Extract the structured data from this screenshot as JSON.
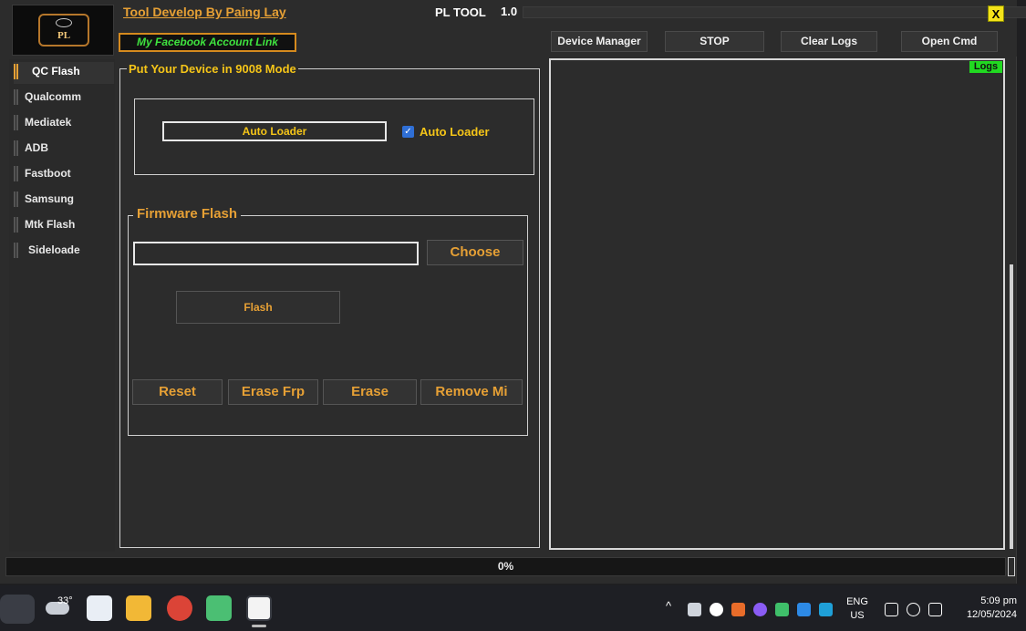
{
  "app": {
    "developer_link": "Tool Develop By Paing Lay",
    "name": "PL TOOL",
    "version": "1.0",
    "logo_text": "PL",
    "close_glyph": "X",
    "facebook_link": "My Facebook Account Link"
  },
  "toolbar": {
    "device_manager": "Device Manager",
    "stop": "STOP",
    "clear_logs": "Clear Logs",
    "open_cmd": "Open Cmd"
  },
  "sidebar": {
    "items": [
      {
        "label": "QC Flash",
        "active": true
      },
      {
        "label": "Qualcomm"
      },
      {
        "label": "Mediatek"
      },
      {
        "label": "ADB"
      },
      {
        "label": "Fastboot"
      },
      {
        "label": "Samsung"
      },
      {
        "label": "Mtk Flash"
      },
      {
        "label": "Sideloade"
      }
    ]
  },
  "main": {
    "group_title": "Put Your Device in 9008 Mode",
    "loader_value": "Auto Loader",
    "auto_loader_checkbox": {
      "label": "Auto Loader",
      "checked": true
    },
    "firmware": {
      "title": "Firmware Flash",
      "path_value": "",
      "choose": "Choose",
      "flash": "Flash",
      "actions": [
        "Reset",
        "Erase Frp",
        "Erase",
        "Remove Mi"
      ]
    }
  },
  "logs": {
    "label": "Logs"
  },
  "progress": {
    "value": 0,
    "text": "0%"
  },
  "taskbar": {
    "weather_temp": "33°",
    "apps": [
      "widgets-icon",
      "store-icon",
      "file-explorer-icon",
      "chrome-icon",
      "minecraft-icon",
      "pl-tool-icon"
    ],
    "lang_line1": "ENG",
    "lang_line2": "US",
    "time": "5:09 pm",
    "date": "12/05/2024"
  },
  "colors": {
    "accent_orange": "#e6a035",
    "title_yellow": "#f5c518",
    "logs_green": "#21d921",
    "window_bg": "#2c2c2c"
  }
}
